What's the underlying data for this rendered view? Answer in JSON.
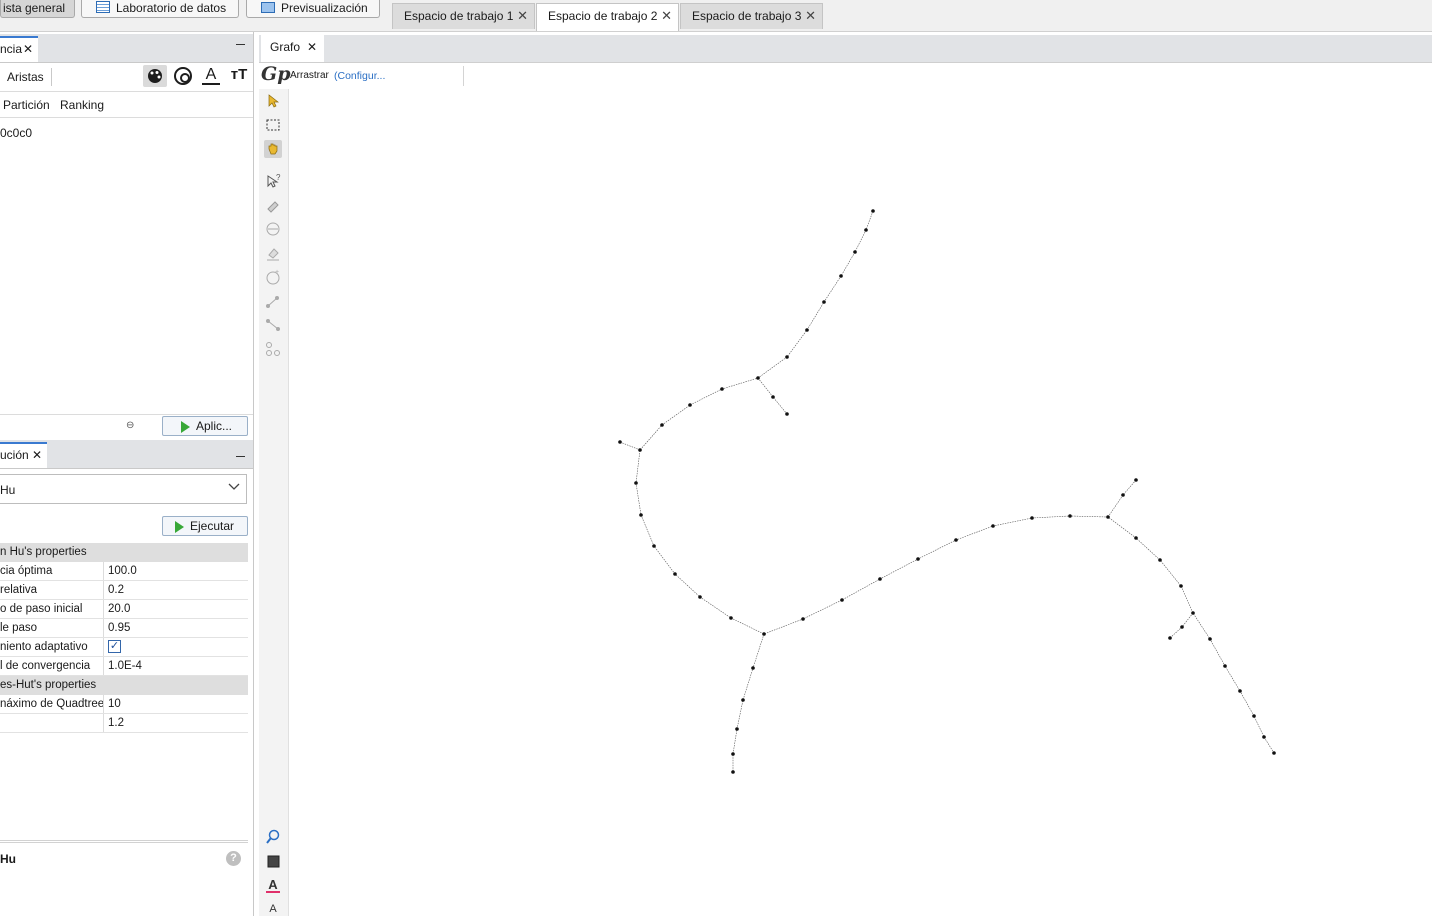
{
  "topbar": {
    "buttons": [
      {
        "label": "ista general",
        "icon": "overview-icon"
      },
      {
        "label": "Laboratorio de datos",
        "icon": "table-icon"
      },
      {
        "label": "Previsualización",
        "icon": "monitor-icon"
      }
    ],
    "workspace_tabs": [
      {
        "label": "Espacio de trabajo 1"
      },
      {
        "label": "Espacio de trabajo 2",
        "active": true
      },
      {
        "label": "Espacio de trabajo 3"
      }
    ]
  },
  "appearance": {
    "tab_label": "ncia",
    "subtab": "Aristas",
    "mode_tabs": [
      "Partición",
      "Ranking"
    ],
    "color_value": "0c0c0",
    "apply_label": "Aplic...",
    "icons": [
      "palette-icon",
      "size-icon",
      "text-color-icon",
      "text-size-icon"
    ]
  },
  "layout": {
    "tab_label": "ución",
    "algorithm": "Hu",
    "run_label": "Ejecutar",
    "groups": [
      {
        "title": "n Hu's properties",
        "rows": [
          {
            "key": "cia óptima",
            "value": "100.0"
          },
          {
            "key": "relativa",
            "value": "0.2"
          },
          {
            "key": "o de paso inicial",
            "value": "20.0"
          },
          {
            "key": "le paso",
            "value": "0.95"
          },
          {
            "key": "niento adaptativo",
            "value": "",
            "checkbox": true
          },
          {
            "key": "l de convergencia",
            "value": "1.0E-4"
          }
        ]
      },
      {
        "title": "es-Hut's properties",
        "rows": [
          {
            "key": "náximo de Quadtree",
            "value": "10"
          },
          {
            "key": "",
            "value": "1.2"
          }
        ]
      }
    ],
    "footer_title": "Hu"
  },
  "graph": {
    "tab_label": "Grafo",
    "tool_label": "Arrastrar",
    "config_label": "(Configur...",
    "colors": {
      "accent": "#3a7ad0",
      "link": "#2b6fc4",
      "node": "#111111",
      "edge": "#555555"
    }
  }
}
